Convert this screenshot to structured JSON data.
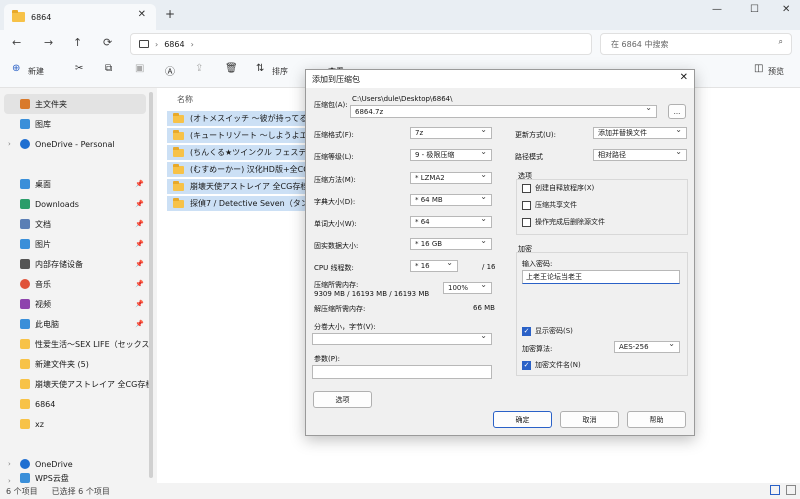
{
  "window": {
    "tab_title": "6864",
    "minimize": "—",
    "maximize": "☐",
    "close": "✕",
    "tab_close": "✕",
    "tab_add": "+"
  },
  "nav": {
    "back": "←",
    "forward": "→",
    "up": "↑",
    "refresh": "⟳",
    "breadcrumb": "6864",
    "search_placeholder": "在 6864 中搜索"
  },
  "toolbar": {
    "new": "新建",
    "sort": "排序",
    "view": "查看",
    "preview": "预览"
  },
  "sidebar": {
    "items": [
      {
        "label": "主文件夹",
        "icon": "home-icon",
        "color": "#d97a2b"
      },
      {
        "label": "图库",
        "icon": "gallery-icon",
        "color": "#3a8fd9"
      },
      {
        "label": "OneDrive - Personal",
        "icon": "onedrive-icon",
        "color": "#1f6fd1"
      },
      {
        "label": "桌面",
        "icon": "desktop-icon",
        "color": "#3a8fd9"
      },
      {
        "label": "Downloads",
        "icon": "download-icon",
        "color": "#2a9d6a"
      },
      {
        "label": "文档",
        "icon": "document-icon",
        "color": "#5b7fb5"
      },
      {
        "label": "图片",
        "icon": "picture-icon",
        "color": "#3a8fd9"
      },
      {
        "label": "内部存储设备",
        "icon": "drive-icon",
        "color": "#555555"
      },
      {
        "label": "音乐",
        "icon": "music-icon",
        "color": "#e0533a"
      },
      {
        "label": "视频",
        "icon": "video-icon",
        "color": "#8e44ad"
      },
      {
        "label": "此电脑",
        "icon": "computer-icon",
        "color": "#3a8fd9"
      },
      {
        "label": "性爱生活～SEX LIFE（セックス",
        "icon": "folder-icon",
        "color": "#f7c248"
      },
      {
        "label": "新建文件夹 (5)",
        "icon": "folder-icon",
        "color": "#f7c248"
      },
      {
        "label": "崩壊天使アストレイア 全CG存档",
        "icon": "folder-icon",
        "color": "#f7c248"
      },
      {
        "label": "6864",
        "icon": "folder-icon",
        "color": "#f7c248"
      },
      {
        "label": "xz",
        "icon": "folder-icon",
        "color": "#f7c248"
      },
      {
        "label": "OneDrive",
        "icon": "onedrive-icon",
        "color": "#1f6fd1"
      },
      {
        "label": "WPS云盘",
        "icon": "cloud-icon",
        "color": "#3a8fd9"
      }
    ]
  },
  "content": {
    "column_name": "名称",
    "files": [
      "(オトメスイッチ ～彼が持ってる彼",
      "(キュートリゾート ～しようよエッ",
      "(ちんくる★ツインクル フェスティ",
      "(むすめーかー) 汉化HD版+全CG",
      "崩壊天使アストレイア 全CG存档",
      "探偵7 / Detective Seven（タンテイ"
    ]
  },
  "status": {
    "count": "6 个项目",
    "selected": "已选择 6 个项目"
  },
  "dialog": {
    "title": "添加到压缩包",
    "archive_label": "压缩包(A):",
    "archive_path": "C:\\Users\\dule\\Desktop\\6864\\",
    "archive_name": "6864.7z",
    "browse": "...",
    "format_label": "压缩格式(F):",
    "format_value": "7z",
    "level_label": "压缩等级(L):",
    "level_value": "9 - 极限压缩",
    "method_label": "压缩方法(M):",
    "method_value": "* LZMA2",
    "dict_label": "字典大小(D):",
    "dict_value": "* 64 MB",
    "word_label": "单词大小(W):",
    "word_value": "* 64",
    "solid_label": "固实数据大小:",
    "solid_value": "* 16 GB",
    "cpu_label": "CPU 线程数:",
    "cpu_value": "* 16",
    "cpu_max": "/ 16",
    "mem_label": "压缩所需内存:",
    "mem_value": "9309 MB / 16193 MB / 16193 MB",
    "mem_percent": "100%",
    "decomp_label": "解压缩所需内存:",
    "decomp_value": "66 MB",
    "split_label": "分卷大小，字节(V):",
    "params_label": "参数(P):",
    "options_button": "选项",
    "update_label": "更新方式(U):",
    "update_value": "添加并替换文件",
    "pathmode_label": "路径模式",
    "pathmode_value": "相对路径",
    "options_group": "选项",
    "opt_sfx": "创建自释放程序(X)",
    "opt_shared": "压缩共享文件",
    "opt_delete": "操作完成后删除源文件",
    "encrypt_group": "加密",
    "password_label": "输入密码:",
    "password_value": "上老王论坛当老王",
    "show_password": "显示密码(S)",
    "encrypt_method_label": "加密算法:",
    "encrypt_method_value": "AES-256",
    "encrypt_names": "加密文件名(N)",
    "ok": "确定",
    "cancel": "取消",
    "help": "帮助"
  }
}
